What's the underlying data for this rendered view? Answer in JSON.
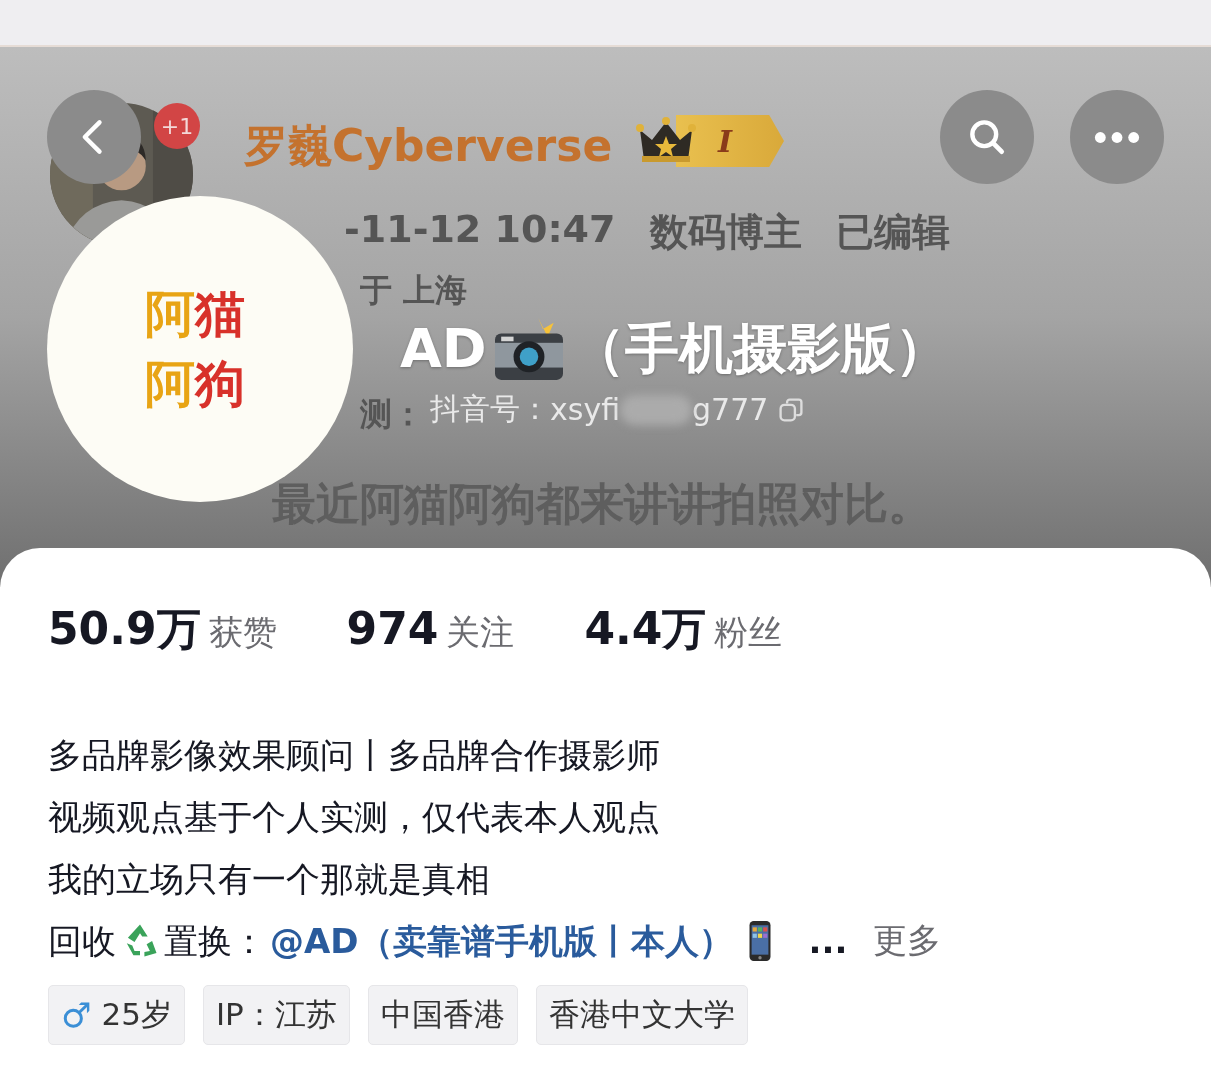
{
  "background_post": {
    "author": "罗巍Cyberverse",
    "notice_count": "+1",
    "level": "I",
    "meta": [
      "-11-12 10:47",
      "数码博主",
      "已编辑"
    ],
    "location": "于 上海",
    "fragment": "测：",
    "sentence": "最近阿猫阿狗都来讲讲拍照对比。"
  },
  "top_buttons": [
    {
      "kind": "back"
    },
    {
      "kind": "search"
    },
    {
      "kind": "more"
    }
  ],
  "profile": {
    "avatar_lines": [
      [
        {
          "text": "阿",
          "color": "#e8a414"
        },
        {
          "text": "猫",
          "color": "#d8312a"
        }
      ],
      [
        {
          "text": "阿",
          "color": "#e8a414"
        },
        {
          "text": "狗",
          "color": "#d8312a"
        }
      ]
    ],
    "name_start": "AD",
    "name_end": "（手机摄影版）",
    "id_label": "抖音号：",
    "id_start": "xsyfi",
    "id_end": "g777"
  },
  "stats": [
    {
      "value": "50.9万",
      "label": "获赞"
    },
    {
      "value": "974",
      "label": "关注"
    },
    {
      "value": "4.4万",
      "label": "粉丝"
    }
  ],
  "bio": {
    "lines": [
      "多品牌影像效果顾问丨多品牌合作摄影师",
      "视频观点基于个人实测，仅代表本人观点",
      "我的立场只有一个那就是真相"
    ],
    "last_line": {
      "before_icon": "回收",
      "after_icon": "置换：",
      "link": "@AD（卖靠谱手机版丨本人）",
      "ellipsis": "...",
      "more": "更多"
    }
  },
  "tags": [
    {
      "kind": "gender",
      "icon": "♂",
      "text": "25岁"
    },
    {
      "kind": "plain",
      "text": "IP：江苏"
    },
    {
      "kind": "plain",
      "text": "中国香港"
    },
    {
      "kind": "plain",
      "text": "香港中文大学"
    }
  ]
}
